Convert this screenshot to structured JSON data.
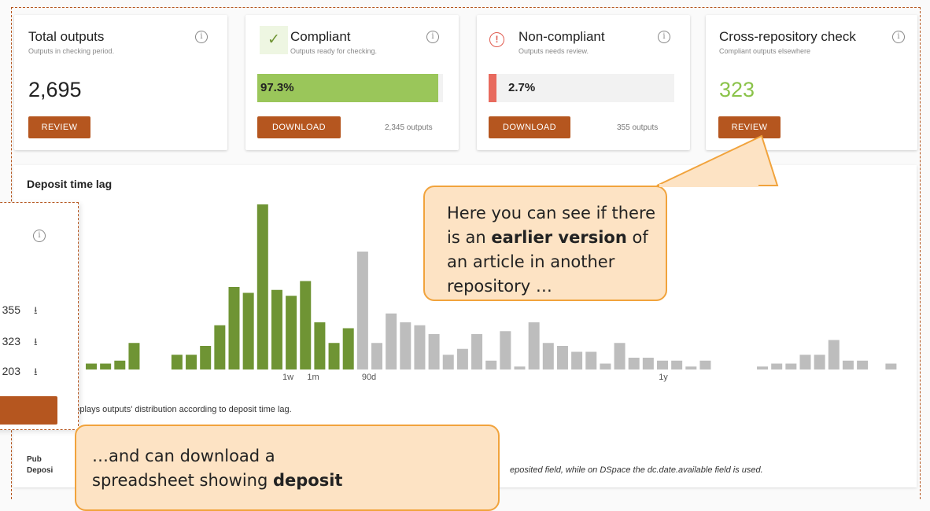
{
  "cards": {
    "total": {
      "title": "Total outputs",
      "subtitle": "Outputs in checking period.",
      "value": "2,695",
      "button": "REVIEW"
    },
    "compliant": {
      "title": "Compliant",
      "subtitle": "Outputs ready for checking.",
      "percent_label": "97.3%",
      "percent": 97.3,
      "button": "DOWNLOAD",
      "count": "2,345 outputs"
    },
    "noncompliant": {
      "title": "Non-compliant",
      "subtitle": "Outputs needs review.",
      "percent_label": "2.7%",
      "percent": 2.7,
      "button": "DOWNLOAD",
      "count": "355 outputs"
    },
    "crossrepo": {
      "title": "Cross-repository check",
      "subtitle": "Compliant outputs elsewhere",
      "value": "323",
      "button": "REVIEW"
    }
  },
  "chart": {
    "title": "Deposit time lag",
    "caption_left": "lisplays outputs' distribution according to deposit time lag.",
    "caption_pub": "Pub",
    "caption_deposit": "Deposi",
    "caption_right": "eposited field, while on DSpace the dc.date.available field is used."
  },
  "chart_data": {
    "type": "bar",
    "x_tick_labels": [
      "1w",
      "1m",
      "90d",
      "1y"
    ],
    "values": [
      2,
      2,
      3,
      9,
      0,
      0,
      5,
      5,
      8,
      15,
      28,
      26,
      56,
      27,
      25,
      30,
      16,
      9,
      14,
      40,
      9,
      19,
      16,
      15,
      12,
      5,
      7,
      12,
      3,
      13,
      1,
      16,
      9,
      8,
      6,
      6,
      2,
      9,
      4,
      4,
      3,
      3,
      1,
      3,
      0,
      0,
      0,
      1,
      2,
      2,
      5,
      5,
      10,
      3,
      3,
      0,
      2
    ],
    "compliant_count": 19,
    "colors": {
      "compliant": "#6f9434",
      "other": "#bdbdbd"
    }
  },
  "overlay": {
    "rows": [
      {
        "value": "355"
      },
      {
        "value": "323"
      },
      {
        "value": "203"
      }
    ]
  },
  "callouts": {
    "top": {
      "pre": "Here you can see if there is an",
      "bold": "earlier version",
      "post": "of an article in another repository …"
    },
    "bottom": {
      "line1": "…and can download a",
      "pre2": "spreadsheet showing",
      "bold2": "deposit"
    }
  },
  "colors": {
    "brand": "#b5561f",
    "compliant_fill": "#9ac65a",
    "noncompliant_fill": "#e86a5e",
    "callout_bg": "#fde3c4",
    "callout_border": "#f1a33c",
    "green_value": "#8bc34a"
  }
}
